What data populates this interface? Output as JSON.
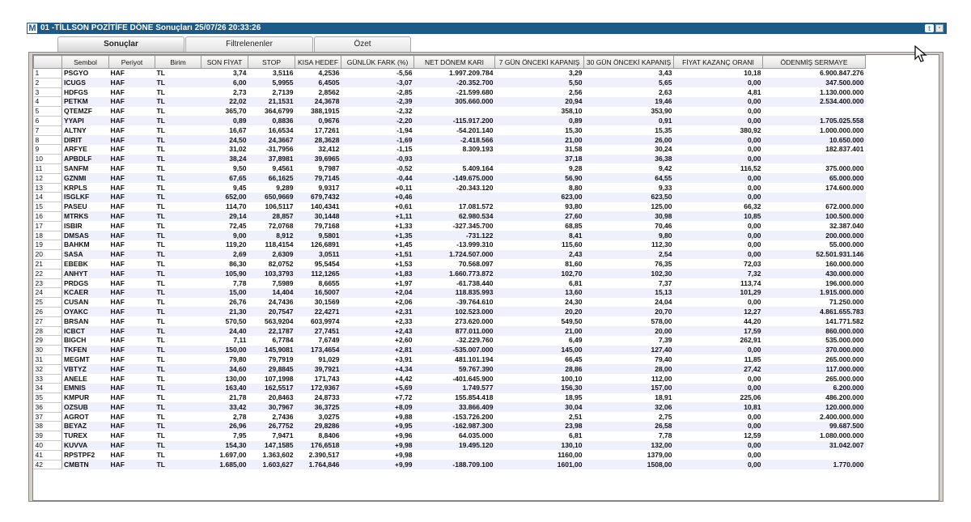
{
  "window": {
    "logo": "M",
    "title": "01 -TİLLSON POZİTİFE DÖNE Sonuçları  25/07/26 20:33:26",
    "twitter_glyph": "t",
    "restore_glyph": "▫"
  },
  "tabs": [
    {
      "label": "Sonuçlar",
      "active": true
    },
    {
      "label": "Filtrelenenler",
      "active": false
    },
    {
      "label": "Özet",
      "active": false
    }
  ],
  "table": {
    "headers": [
      "Sembol",
      "Periyot",
      "Birim",
      "SON FİYAT",
      "STOP",
      "KISA HEDEF",
      "GÜNLÜK FARK (%)",
      "NET DÖNEM KARI",
      "7 GÜN ÖNCEKİ KAPANIŞ",
      "30 GÜN ÖNCEKİ KAPANIŞ",
      "FİYAT KAZANÇ ORANI",
      "ÖDENMİŞ SERMAYE"
    ],
    "rows": [
      [
        "1",
        "PSGYO",
        "HAF",
        "TL",
        "3,74",
        "3,5116",
        "4,2536",
        "-5,56",
        "1.997.209.784",
        "3,29",
        "3,43",
        "10,18",
        "6.900.847.276"
      ],
      [
        "2",
        "ICUGS",
        "HAF",
        "TL",
        "6,00",
        "5,9955",
        "6,4505",
        "-3,07",
        "-20.352.700",
        "5,50",
        "5,65",
        "0,00",
        "347.500.000"
      ],
      [
        "3",
        "HDFGS",
        "HAF",
        "TL",
        "2,73",
        "2,7139",
        "2,8562",
        "-2,85",
        "-21.599.680",
        "2,56",
        "2,63",
        "4,81",
        "1.130.000.000"
      ],
      [
        "4",
        "PETKM",
        "HAF",
        "TL",
        "22,02",
        "21,1531",
        "24,3678",
        "-2,39",
        "305.660.000",
        "20,94",
        "19,46",
        "0,00",
        "2.534.400.000"
      ],
      [
        "5",
        "QTEMZF",
        "HAF",
        "TL",
        "365,70",
        "364,6799",
        "388,1915",
        "-2,32",
        "",
        "358,10",
        "353,90",
        "0,00",
        ""
      ],
      [
        "6",
        "YYAPI",
        "HAF",
        "TL",
        "0,89",
        "0,8836",
        "0,9676",
        "-2,20",
        "-115.917.200",
        "0,89",
        "0,91",
        "0,00",
        "1.705.025.558"
      ],
      [
        "7",
        "ALTNY",
        "HAF",
        "TL",
        "16,67",
        "16,6534",
        "17,7261",
        "-1,94",
        "-54.201.140",
        "15,30",
        "15,35",
        "380,92",
        "1.000.000.000"
      ],
      [
        "8",
        "DIRIT",
        "HAF",
        "TL",
        "24,50",
        "24,3667",
        "28,3628",
        "-1,69",
        "-2.418.566",
        "21,00",
        "26,00",
        "0,00",
        "10.650.000"
      ],
      [
        "9",
        "ARFYE",
        "HAF",
        "TL",
        "31,02",
        "-31,7956",
        "32,412",
        "-1,15",
        "8.309.193",
        "31,58",
        "30,24",
        "0,00",
        "182.837.401"
      ],
      [
        "10",
        "APBDLF",
        "HAF",
        "TL",
        "38,24",
        "37,8981",
        "39,6965",
        "-0,93",
        "",
        "37,18",
        "36,38",
        "0,00",
        ""
      ],
      [
        "11",
        "SANFM",
        "HAF",
        "TL",
        "9,50",
        "9,4561",
        "9,7987",
        "-0,52",
        "5.409.164",
        "9,28",
        "9,42",
        "116,52",
        "375.000.000"
      ],
      [
        "12",
        "GZNMI",
        "HAF",
        "TL",
        "67,65",
        "66,1625",
        "79,7145",
        "-0,44",
        "-149.675.000",
        "56,90",
        "64,55",
        "0,00",
        "65.000.000"
      ],
      [
        "13",
        "KRPLS",
        "HAF",
        "TL",
        "9,45",
        "9,289",
        "9,9317",
        "+0,11",
        "-20.343.120",
        "8,80",
        "9,33",
        "0,00",
        "174.600.000"
      ],
      [
        "14",
        "ISGLKF",
        "HAF",
        "TL",
        "652,00",
        "650,9669",
        "679,7432",
        "+0,46",
        "",
        "623,00",
        "623,50",
        "0,00",
        ""
      ],
      [
        "15",
        "PASEU",
        "HAF",
        "TL",
        "114,70",
        "106,5117",
        "140,4341",
        "+0,61",
        "17.081.572",
        "93,80",
        "125,00",
        "66,32",
        "672.000.000"
      ],
      [
        "16",
        "MTRKS",
        "HAF",
        "TL",
        "29,14",
        "28,857",
        "30,1448",
        "+1,11",
        "62.980.534",
        "27,60",
        "30,98",
        "10,85",
        "100.500.000"
      ],
      [
        "17",
        "ISBIR",
        "HAF",
        "TL",
        "72,45",
        "72,0768",
        "79,7168",
        "+1,33",
        "-327.345.700",
        "68,85",
        "70,46",
        "0,00",
        "32.387.040"
      ],
      [
        "18",
        "DMSAS",
        "HAF",
        "TL",
        "9,00",
        "8,912",
        "9,5801",
        "+1,35",
        "-731.122",
        "8,41",
        "9,80",
        "0,00",
        "200.000.000"
      ],
      [
        "19",
        "BAHKM",
        "HAF",
        "TL",
        "119,20",
        "118,4154",
        "126,6891",
        "+1,45",
        "-13.999.310",
        "115,60",
        "112,30",
        "0,00",
        "55.000.000"
      ],
      [
        "20",
        "SASA",
        "HAF",
        "TL",
        "2,69",
        "2,6309",
        "3,0511",
        "+1,51",
        "1.724.507.000",
        "2,43",
        "2,54",
        "0,00",
        "52.501.931.146"
      ],
      [
        "21",
        "EBEBK",
        "HAF",
        "TL",
        "86,30",
        "82,0752",
        "95,5454",
        "+1,53",
        "70.568.097",
        "81,60",
        "76,35",
        "72,03",
        "160.000.000"
      ],
      [
        "22",
        "ANHYT",
        "HAF",
        "TL",
        "105,90",
        "103,3793",
        "112,1265",
        "+1,83",
        "1.660.773.872",
        "102,70",
        "102,30",
        "7,32",
        "430.000.000"
      ],
      [
        "23",
        "PRDGS",
        "HAF",
        "TL",
        "7,78",
        "7,5989",
        "8,6655",
        "+1,97",
        "-61.738.440",
        "6,81",
        "7,37",
        "113,74",
        "196.000.000"
      ],
      [
        "24",
        "KCAER",
        "HAF",
        "TL",
        "15,00",
        "14,404",
        "16,5007",
        "+2,04",
        "118.835.993",
        "13,60",
        "15,13",
        "101,29",
        "1.915.000.000"
      ],
      [
        "25",
        "CUSAN",
        "HAF",
        "TL",
        "26,76",
        "24,7436",
        "30,1569",
        "+2,06",
        "-39.764.610",
        "24,30",
        "24,04",
        "0,00",
        "71.250.000"
      ],
      [
        "26",
        "OYAKC",
        "HAF",
        "TL",
        "21,30",
        "20,7547",
        "22,4271",
        "+2,31",
        "102.523.000",
        "20,20",
        "20,70",
        "12,27",
        "4.861.655.783"
      ],
      [
        "27",
        "BRSAN",
        "HAF",
        "TL",
        "570,50",
        "563,9204",
        "603,9974",
        "+2,33",
        "273.620.000",
        "549,50",
        "578,00",
        "44,20",
        "141.771.582"
      ],
      [
        "28",
        "ICBCT",
        "HAF",
        "TL",
        "24,40",
        "22,1787",
        "27,7451",
        "+2,43",
        "877.011.000",
        "21,00",
        "20,00",
        "17,59",
        "860.000.000"
      ],
      [
        "29",
        "BIGCH",
        "HAF",
        "TL",
        "7,11",
        "6,7784",
        "7,6749",
        "+2,60",
        "-32.229.760",
        "6,49",
        "7,39",
        "262,91",
        "535.000.000"
      ],
      [
        "30",
        "TKFEN",
        "HAF",
        "TL",
        "150,00",
        "145,9081",
        "173,4654",
        "+2,81",
        "-535.007.000",
        "145,00",
        "127,40",
        "0,00",
        "370.000.000"
      ],
      [
        "31",
        "MEGMT",
        "HAF",
        "TL",
        "79,80",
        "79,7919",
        "91,029",
        "+3,91",
        "481.101.194",
        "66,45",
        "79,40",
        "11,85",
        "265.000.000"
      ],
      [
        "32",
        "VBTYZ",
        "HAF",
        "TL",
        "34,60",
        "29,8845",
        "39,7921",
        "+4,34",
        "59.767.390",
        "28,86",
        "28,00",
        "27,42",
        "117.000.000"
      ],
      [
        "33",
        "ANELE",
        "HAF",
        "TL",
        "130,00",
        "107,1998",
        "171,743",
        "+4,42",
        "-401.645.900",
        "100,10",
        "112,00",
        "0,00",
        "265.000.000"
      ],
      [
        "34",
        "EMNIS",
        "HAF",
        "TL",
        "163,40",
        "162,5517",
        "172,9367",
        "+5,69",
        "1.749.577",
        "156,30",
        "157,00",
        "0,00",
        "6.200.000"
      ],
      [
        "35",
        "KMPUR",
        "HAF",
        "TL",
        "21,78",
        "20,8463",
        "24,8733",
        "+7,72",
        "155.854.418",
        "18,95",
        "18,91",
        "225,06",
        "486.200.000"
      ],
      [
        "36",
        "OZSUB",
        "HAF",
        "TL",
        "33,42",
        "30,7967",
        "36,3725",
        "+8,09",
        "33.866.409",
        "30,04",
        "32,06",
        "10,81",
        "120.000.000"
      ],
      [
        "37",
        "AGROT",
        "HAF",
        "TL",
        "2,78",
        "2,7436",
        "3,0275",
        "+9,88",
        "-153.726.200",
        "2,51",
        "2,75",
        "0,00",
        "2.400.000.000"
      ],
      [
        "38",
        "BEYAZ",
        "HAF",
        "TL",
        "26,96",
        "26,7752",
        "29,8286",
        "+9,95",
        "-162.987.300",
        "23,98",
        "26,58",
        "0,00",
        "99.687.500"
      ],
      [
        "39",
        "TUREX",
        "HAF",
        "TL",
        "7,95",
        "7,9471",
        "8,8406",
        "+9,96",
        "64.035.000",
        "6,81",
        "7,78",
        "12,59",
        "1.080.000.000"
      ],
      [
        "40",
        "KUVVA",
        "HAF",
        "TL",
        "154,30",
        "147,1585",
        "176,6518",
        "+9,98",
        "19.495.120",
        "130,10",
        "132,00",
        "0,00",
        "31.042.007"
      ],
      [
        "41",
        "RPSTPF2",
        "HAF",
        "TL",
        "1.697,00",
        "1.363,602",
        "2.390,517",
        "+9,98",
        "",
        "1160,00",
        "1379,00",
        "0,00",
        ""
      ],
      [
        "42",
        "CMBTN",
        "HAF",
        "TL",
        "1.685,00",
        "1.603,627",
        "1.764,846",
        "+9,99",
        "-188.709.100",
        "1601,00",
        "1508,00",
        "0,00",
        "1.770.000"
      ]
    ]
  }
}
